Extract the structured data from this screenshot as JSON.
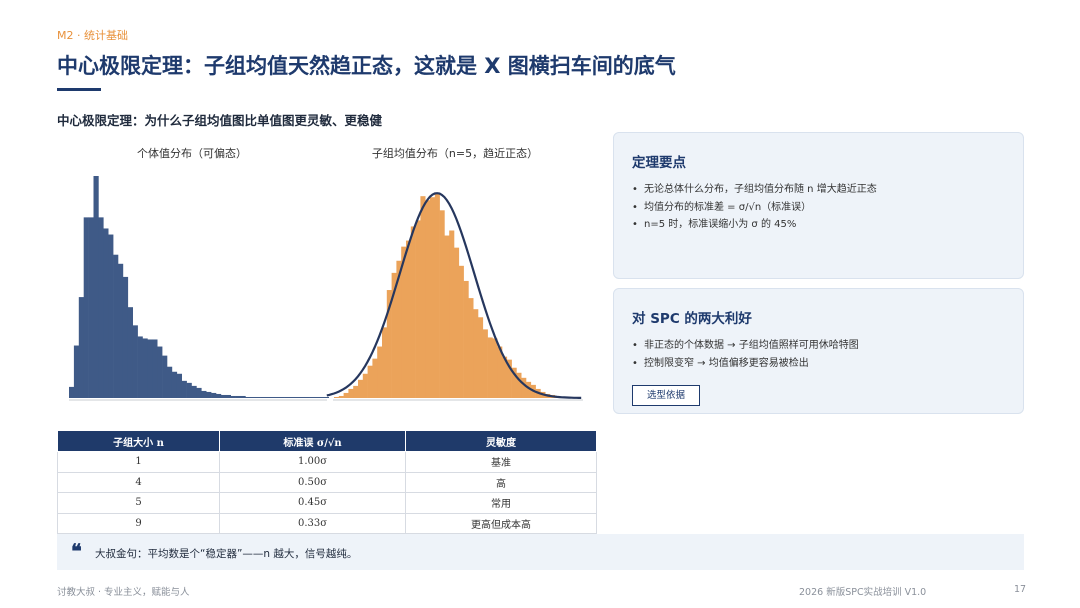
{
  "header": {
    "module_tag": "M2 · 统计基础",
    "title": "中心极限定理：子组均值天然趋正态，这就是 X 图横扫车间的底气",
    "subtitle": "中心极限定理：为什么子组均值图比单值图更灵敏、更稳健"
  },
  "colors": {
    "primary": "#1e3a6d",
    "accent": "#e8913a",
    "individual_bars": "#3f5a87",
    "subgroup_bars": "#eba35a",
    "card_bg": "#eef3f9"
  },
  "chart_data": [
    {
      "type": "bar",
      "title": "个体值分布（可偏态）",
      "values": [
        11,
        52,
        100,
        179,
        179,
        220,
        179,
        168,
        162,
        142,
        133,
        120,
        90,
        72,
        61,
        59,
        58,
        58,
        51,
        42,
        31,
        26,
        24,
        17,
        15,
        12,
        10,
        7,
        6,
        5,
        4,
        3,
        3,
        2,
        2,
        2,
        1,
        1,
        1,
        1,
        1,
        1,
        1,
        1,
        1,
        1,
        1,
        1,
        1,
        1,
        1,
        1,
        1
      ]
    },
    {
      "type": "bar",
      "title": "子组均值分布（n=5，趋近正态）",
      "values": [
        1,
        2,
        5,
        9,
        12,
        18,
        24,
        32,
        39,
        51,
        70,
        107,
        124,
        136,
        150,
        156,
        170,
        176,
        200,
        196,
        199,
        203,
        186,
        161,
        166,
        149,
        131,
        116,
        99,
        88,
        80,
        68,
        60,
        59,
        51,
        41,
        38,
        30,
        25,
        20,
        16,
        13,
        9,
        6,
        4,
        3,
        2,
        1,
        1,
        1
      ],
      "overlay": "normal-curve"
    }
  ],
  "table": {
    "headers": [
      "子组大小 n",
      "标准误 σ/√n",
      "灵敏度"
    ],
    "rows": [
      [
        "1",
        "1.00σ",
        "基准"
      ],
      [
        "4",
        "0.50σ",
        "高"
      ],
      [
        "5",
        "0.45σ",
        "常用"
      ],
      [
        "9",
        "0.33σ",
        "更高但成本高"
      ]
    ]
  },
  "cards": [
    {
      "title": "定理要点",
      "items": [
        "无论总体什么分布，子组均值分布随 n 增大趋近正态",
        "均值分布的标准差 = σ/√n（标准误）",
        "n=5 时，标准误缩小为 σ 的 45%"
      ]
    },
    {
      "title": "对 SPC 的两大利好",
      "items": [
        "非正态的个体数据 → 子组均值照样可用休哈特图",
        "控制限变窄 → 均值偏移更容易被检出"
      ],
      "button": "选型依据"
    }
  ],
  "quote": {
    "icon": "quote-icon",
    "text": "大叔金句：平均数是个“稳定器”——n 越大，信号越纯。"
  },
  "footer": {
    "left": "讨教大叔 · 专业主义，赋能与人",
    "right": "2026 新版SPC实战培训 V1.0",
    "page": "17"
  }
}
